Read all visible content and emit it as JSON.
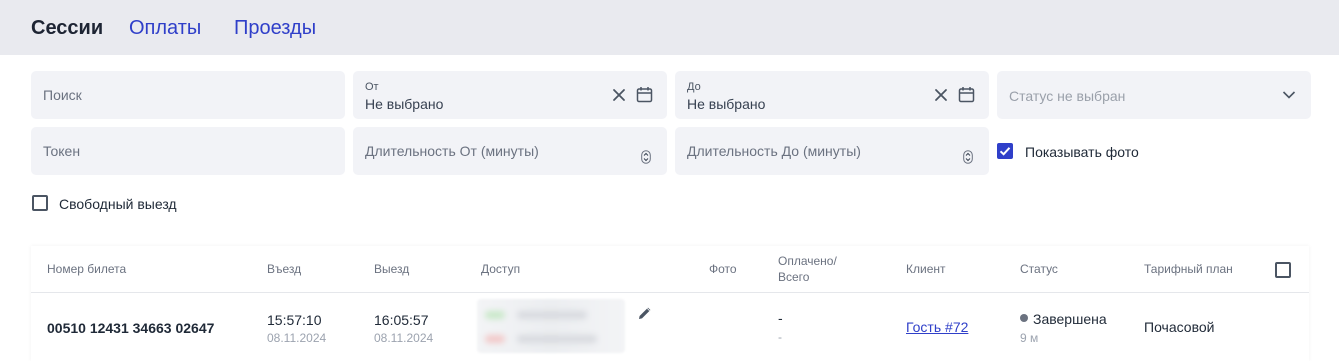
{
  "tabs": [
    {
      "label": "Сессии",
      "active": true
    },
    {
      "label": "Оплаты",
      "active": false
    },
    {
      "label": "Проезды",
      "active": false
    }
  ],
  "filters": {
    "search_placeholder": "Поиск",
    "from_label": "От",
    "from_value": "Не выбрано",
    "to_label": "До",
    "to_value": "Не выбрано",
    "status_placeholder": "Статус не выбран",
    "token_placeholder": "Токен",
    "duration_from_placeholder": "Длительность От (минуты)",
    "duration_to_placeholder": "Длительность До (минуты)",
    "show_photo_label": "Показывать фото",
    "show_photo_checked": true,
    "free_exit_label": "Свободный выезд",
    "free_exit_checked": false
  },
  "table": {
    "headers": {
      "ticket": "Номер билета",
      "entry": "Въезд",
      "exit": "Выезд",
      "access": "Доступ",
      "photo": "Фото",
      "paid_line1": "Оплачено/",
      "paid_line2": "Всего",
      "client": "Клиент",
      "status": "Статус",
      "tariff": "Тарифный план"
    },
    "rows": [
      {
        "ticket": "00510 12431 34663 02647",
        "entry_time": "15:57:10",
        "entry_date": "08.11.2024",
        "exit_time": "16:05:57",
        "exit_date": "08.11.2024",
        "paid": "-",
        "total": "-",
        "client": "Гость #72",
        "status": "Завершена",
        "duration": "9 м",
        "tariff": "Почасовой"
      }
    ]
  },
  "colors": {
    "accent": "#2f3fc9",
    "tab_bar": "#e9eaef",
    "field_bg": "#f2f3f7"
  }
}
